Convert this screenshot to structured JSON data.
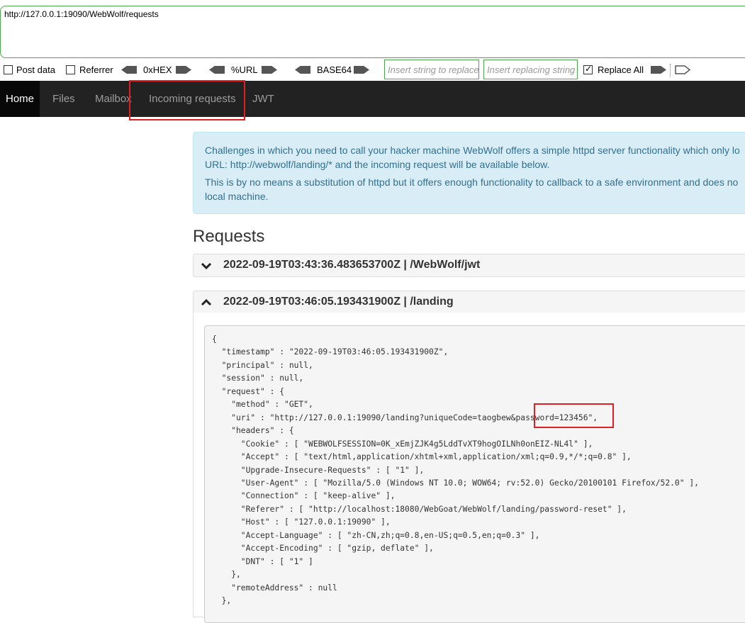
{
  "address": {
    "url": "http://127.0.0.1:19090/WebWolf/requests"
  },
  "toolbar": {
    "post_data_label": "Post data",
    "referrer_label": "Referrer",
    "hex_label": "0xHEX",
    "url_label": "%URL",
    "base64_label": "BASE64",
    "insert_string_placeholder": "Insert string to replace",
    "insert_replacing_placeholder": "Insert replacing string",
    "replace_all_label": "Replace All",
    "replace_all_checked": true
  },
  "nav": {
    "items": [
      {
        "label": "Home",
        "active": true
      },
      {
        "label": "Files"
      },
      {
        "label": "Mailbox"
      },
      {
        "label": "Incoming requests"
      },
      {
        "label": "JWT"
      }
    ]
  },
  "alert": {
    "line1": "Challenges in which you need to call your hacker machine WebWolf offers a simple httpd server functionality which only lo",
    "line2": "URL: http://webwolf/landing/* and the incoming request will be available below.",
    "line3": "This is by no means a substitution of httpd but it offers enough functionality to callback to a safe environment and does no",
    "line4": "local machine."
  },
  "requests": {
    "title": "Requests",
    "items": [
      {
        "title": "2022-09-19T03:43:36.483653700Z | /WebWolf/jwt",
        "expanded": false
      },
      {
        "title": "2022-09-19T03:46:05.193431900Z | /landing",
        "expanded": true
      }
    ],
    "detail_json": "{\n  \"timestamp\" : \"2022-09-19T03:46:05.193431900Z\",\n  \"principal\" : null,\n  \"session\" : null,\n  \"request\" : {\n    \"method\" : \"GET\",\n    \"uri\" : \"http://127.0.0.1:19090/landing?uniqueCode=taogbew&password=123456\",\n    \"headers\" : {\n      \"Cookie\" : [ \"WEBWOLFSESSION=0K_xEmjZJK4g5LddTvXT9hogOILNh0onEIZ-NL4l\" ],\n      \"Accept\" : [ \"text/html,application/xhtml+xml,application/xml;q=0.9,*/*;q=0.8\" ],\n      \"Upgrade-Insecure-Requests\" : [ \"1\" ],\n      \"User-Agent\" : [ \"Mozilla/5.0 (Windows NT 10.0; WOW64; rv:52.0) Gecko/20100101 Firefox/52.0\" ],\n      \"Connection\" : [ \"keep-alive\" ],\n      \"Referer\" : [ \"http://localhost:18080/WebGoat/WebWolf/landing/password-reset\" ],\n      \"Host\" : [ \"127.0.0.1:19090\" ],\n      \"Accept-Language\" : [ \"zh-CN,zh;q=0.8,en-US;q=0.5,en;q=0.3\" ],\n      \"Accept-Encoding\" : [ \"gzip, deflate\" ],\n      \"DNT\" : [ \"1\" ]\n    },\n    \"remoteAddress\" : null\n  },"
  },
  "colors": {
    "navbar_bg": "#222222",
    "active_nav_bg": "#080808",
    "alert_bg": "#d9edf7",
    "alert_text": "#31708f",
    "input_border": "#4aa84a",
    "highlight": "#e02020"
  }
}
